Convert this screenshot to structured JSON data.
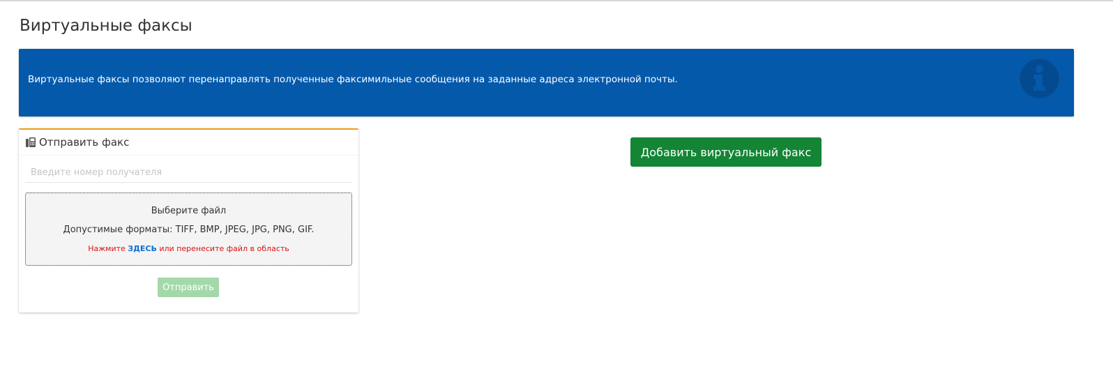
{
  "page": {
    "title": "Виртуальные факсы"
  },
  "info_banner": {
    "text": "Виртуальные факсы позволяют перенаправлять полученные факсимильные сообщения на заданные адреса электронной почты.",
    "icon": "info-circle-icon",
    "background": "#0459ab"
  },
  "send_fax": {
    "title": "Отправить факс",
    "icon": "fax-icon",
    "recipient_input": {
      "placeholder": "Введите номер получателя",
      "value": ""
    },
    "dropzone": {
      "title": "Выберите файл",
      "formats": "Допустимые форматы: TIFF, BMP, JPEG, JPG, PNG, GIF.",
      "hint_prefix": "Нажмите",
      "hint_link": "ЗДЕСЬ",
      "hint_suffix": "или перенесите файл в область"
    },
    "send_label": "Отправить",
    "accent": "#f39c12"
  },
  "actions": {
    "add_label": "Добавить виртуальный факс",
    "add_color": "#138535"
  }
}
